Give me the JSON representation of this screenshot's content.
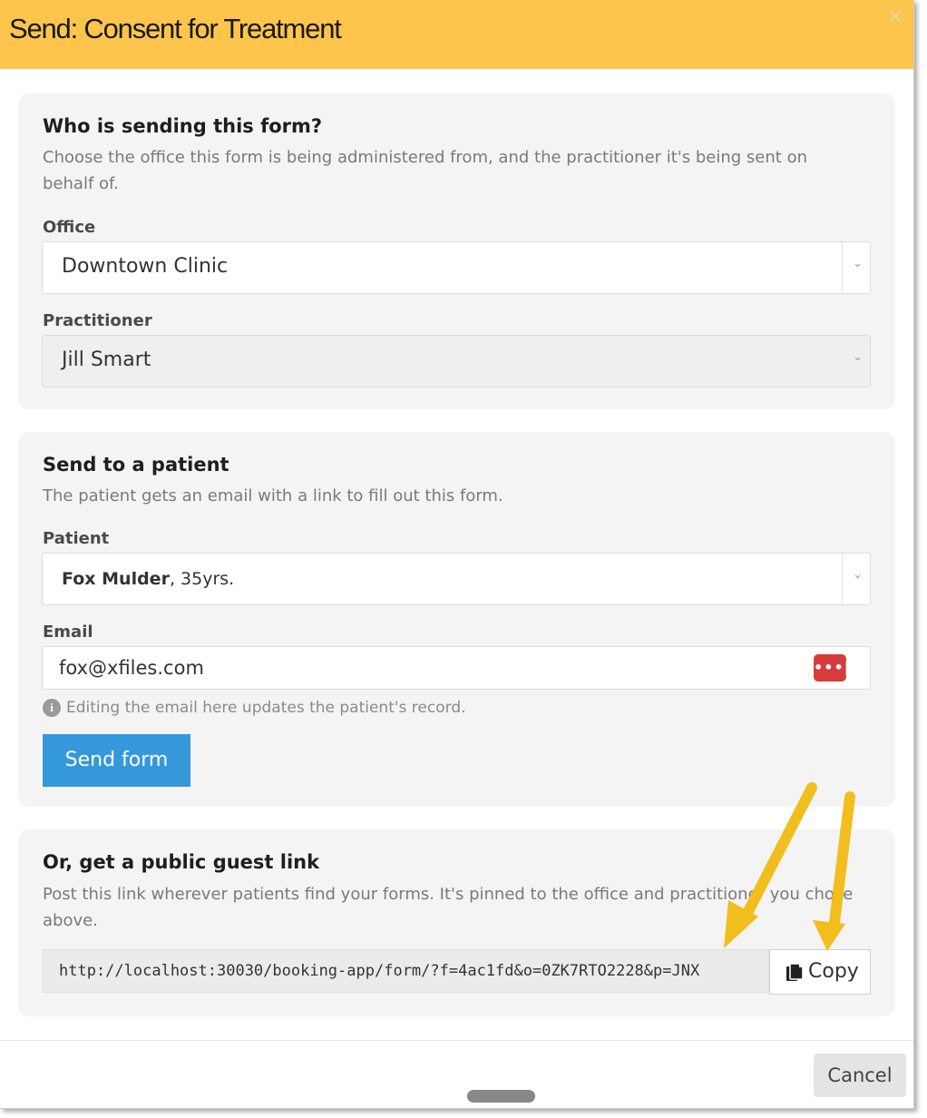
{
  "header": {
    "title": "Send: Consent for Treatment",
    "close_glyph": "×"
  },
  "sender_section": {
    "title": "Who is sending this form?",
    "description": "Choose the office this form is being administered from, and the practitioner it's being sent on behalf of.",
    "office_label": "Office",
    "office_value": "Downtown Clinic",
    "practitioner_label": "Practitioner",
    "practitioner_value": "Jill Smart"
  },
  "patient_section": {
    "title": "Send to a patient",
    "description": "The patient gets an email with a link to fill out this form.",
    "patient_label": "Patient",
    "patient_name": "Fox Mulder",
    "patient_age": ", 35yrs.",
    "email_label": "Email",
    "email_value": "fox@xfiles.com",
    "email_hint": "Editing the email here updates the patient's record.",
    "send_button": "Send form"
  },
  "guest_link_section": {
    "title": "Or, get a public guest link",
    "description": "Post this link wherever patients find your forms. It's pinned to the office and practitioner you chose above.",
    "link": "http://localhost:30030/booking-app/form/?f=4ac1fd&o=0ZK7RTO2228&p=JNX",
    "copy_button": "Copy"
  },
  "footer": {
    "cancel_button": "Cancel"
  },
  "icons": {
    "chevron": "chevron-down-icon",
    "password_manager": "password-manager-icon",
    "info": "info-icon",
    "copy": "copy-icon",
    "close": "close-icon"
  },
  "colors": {
    "header_bg": "#fdc54b",
    "primary": "#3598db",
    "annotation_arrow": "#f2be1e",
    "password_manager": "#d73c3c"
  }
}
